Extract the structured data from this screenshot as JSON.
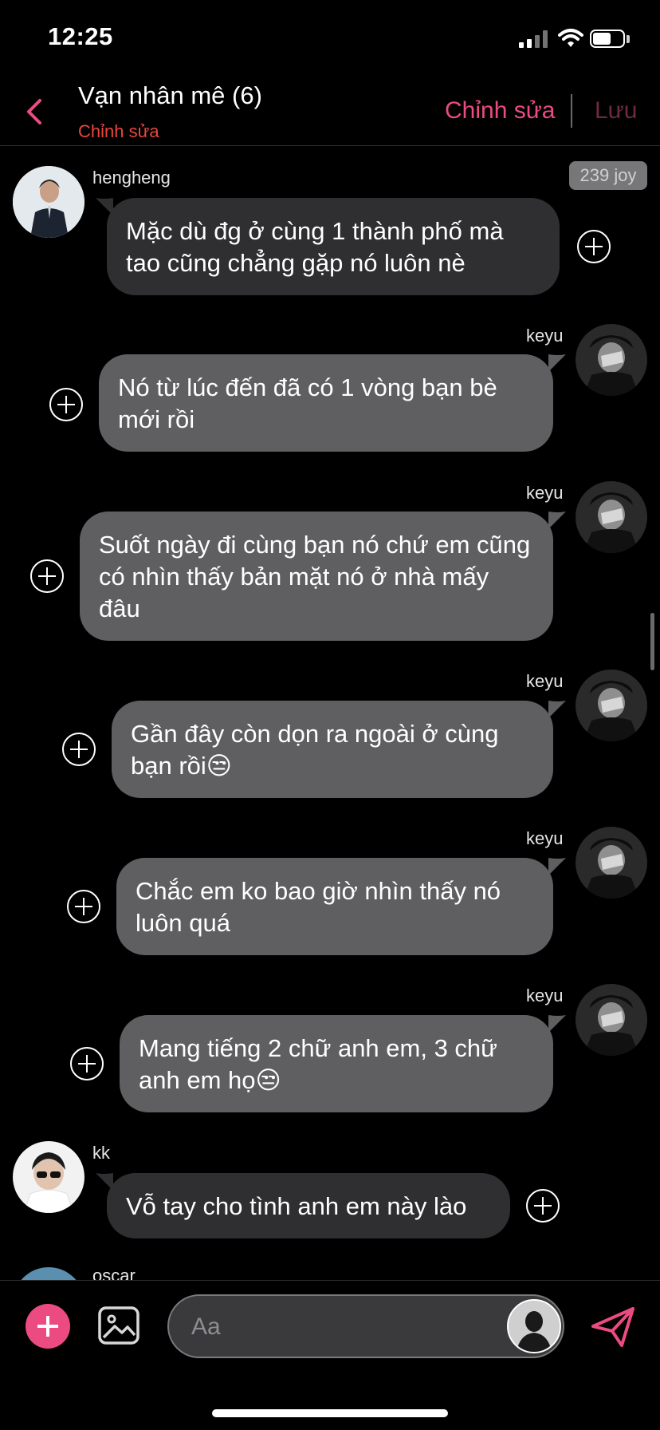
{
  "status_bar": {
    "time": "12:25"
  },
  "header": {
    "title": "Vạn nhân mê (6)",
    "subtitle": "Chỉnh sửa",
    "edit_label": "Chỉnh sửa",
    "save_label": "Lưu"
  },
  "badge": {
    "joy": "239 joy"
  },
  "messages": [
    {
      "sender": "hengheng",
      "text": "Mặc dù đg ở cùng 1 thành phố mà tao cũng chẳng gặp nó luôn nè"
    },
    {
      "sender": "keyu",
      "text": "Nó từ lúc đến đã có 1 vòng bạn bè mới rồi"
    },
    {
      "sender": "keyu",
      "text": "Suốt ngày đi cùng bạn nó chứ em cũng có nhìn thấy bản mặt nó ở nhà mấy đâu"
    },
    {
      "sender": "keyu",
      "text": "Gần đây còn dọn ra ngoài ở cùng bạn rồi😒"
    },
    {
      "sender": "keyu",
      "text": "Chắc em ko bao giờ nhìn thấy nó luôn quá"
    },
    {
      "sender": "keyu",
      "text": "Mang tiếng 2 chữ anh em, 3 chữ anh em họ😒"
    },
    {
      "sender": "kk",
      "text": "Vỗ tay cho tình anh em này lào"
    },
    {
      "sender": "oscar",
      "text": ""
    }
  ],
  "composer": {
    "placeholder": "Aa"
  },
  "colors": {
    "accent": "#ec4b82",
    "subtitle": "#e8473f",
    "bubble_in": "#2f2f31",
    "bubble_out": "#5f5f62"
  }
}
